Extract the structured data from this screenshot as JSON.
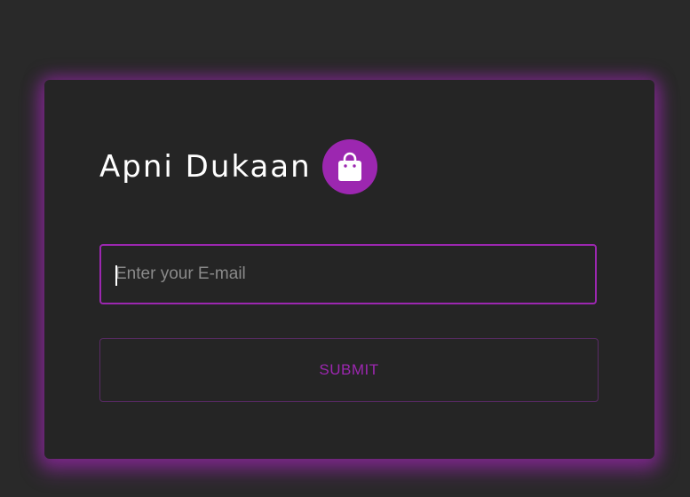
{
  "app": {
    "title": "Apni Dukaan",
    "logo_icon": "shopping-bag-icon"
  },
  "form": {
    "email_placeholder": "Enter your E-mail",
    "email_value": "",
    "submit_label": "SUBMIT"
  },
  "colors": {
    "page_background": "#292929",
    "card_background": "#252525",
    "accent": "#9c27b0",
    "title_text": "#ffffff",
    "placeholder_text": "#8a8a8a"
  }
}
